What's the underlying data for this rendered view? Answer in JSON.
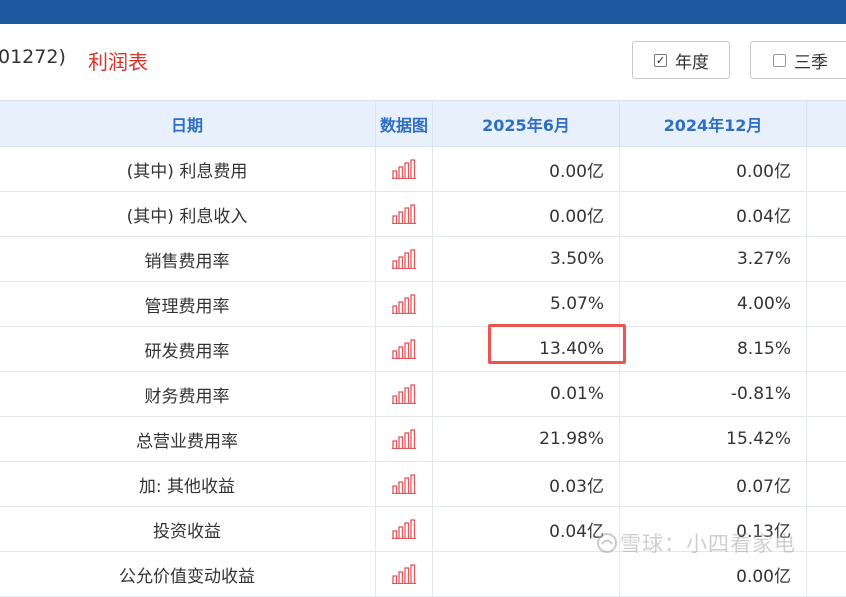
{
  "header": {
    "stock_code": "01272)",
    "statement_title": "利润表",
    "buttons": [
      {
        "label": "年度",
        "checked": true
      },
      {
        "label": "三季",
        "checked": false
      }
    ]
  },
  "table": {
    "columns": [
      "日期",
      "数据图",
      "2025年6月",
      "2024年12月",
      ""
    ],
    "rows": [
      {
        "label": "(其中) 利息费用",
        "v1": "0.00亿",
        "v2": "0.00亿"
      },
      {
        "label": "(其中) 利息收入",
        "v1": "0.00亿",
        "v2": "0.04亿"
      },
      {
        "label": "销售费用率",
        "v1": "3.50%",
        "v2": "3.27%"
      },
      {
        "label": "管理费用率",
        "v1": "5.07%",
        "v2": "4.00%"
      },
      {
        "label": "研发费用率",
        "v1": "13.40%",
        "v2": "8.15%"
      },
      {
        "label": "财务费用率",
        "v1": "0.01%",
        "v2": "-0.81%"
      },
      {
        "label": "总营业费用率",
        "v1": "21.98%",
        "v2": "15.42%"
      },
      {
        "label": "加:  其他收益",
        "v1": "0.03亿",
        "v2": "0.07亿"
      },
      {
        "label": "投资收益",
        "v1": "0.04亿",
        "v2": "0.13亿"
      },
      {
        "label": "公允价值变动收益",
        "v1": "",
        "v2": "0.00亿"
      }
    ]
  },
  "watermark": "雪球：小四看家电",
  "colors": {
    "accent": "#2e6fc3",
    "topbar": "#1f5aa0",
    "title_red": "#d9322b",
    "highlight": "#f05252",
    "chart_icon": "#e0585d"
  },
  "icons": {
    "chart": "bar-chart-icon",
    "check": "check-icon",
    "logo": "xueqiu-logo-icon"
  }
}
